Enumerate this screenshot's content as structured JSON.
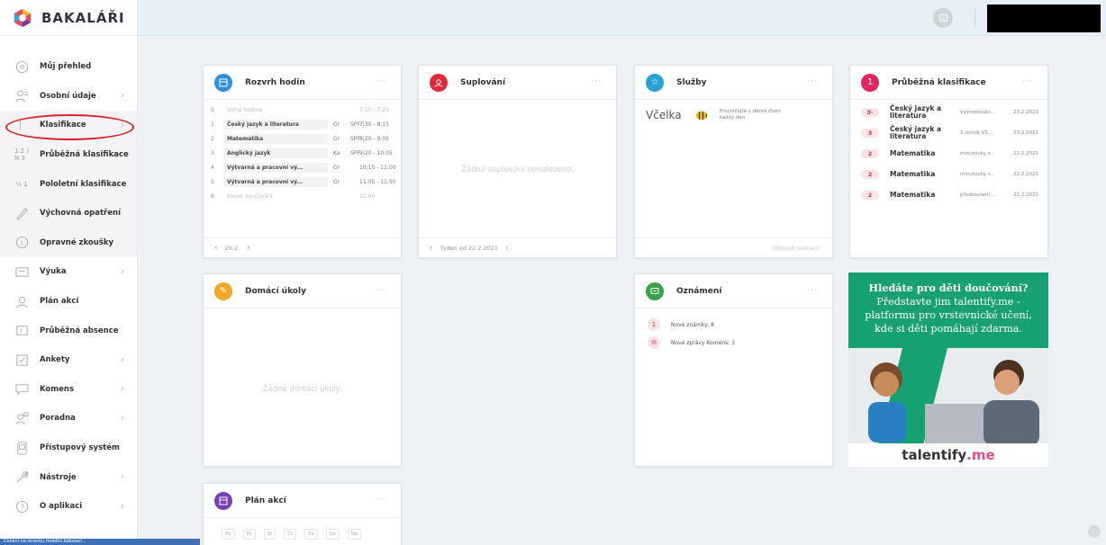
{
  "brand": {
    "name": "BAKALÁŘI"
  },
  "nav": [
    {
      "label": "Můj přehled",
      "icon": "dashboard-icon",
      "chevron": false
    },
    {
      "label": "Osobní údaje",
      "icon": "person-icon",
      "chevron": true
    },
    {
      "label": "Klasifikace",
      "icon": "grades-icon",
      "chevron": true
    },
    {
      "label": "Průběžná klasifikace",
      "icon": "ongoing-grades-icon",
      "chevron": false,
      "glyph": "1 2 / N 3"
    },
    {
      "label": "Pololetní klasifikace",
      "icon": "semester-grades-icon",
      "chevron": false,
      "glyph": "½ 1"
    },
    {
      "label": "Výchovná opatření",
      "icon": "pen-icon",
      "chevron": false
    },
    {
      "label": "Opravné zkoušky",
      "icon": "retake-exam-icon",
      "chevron": false
    },
    {
      "label": "Výuka",
      "icon": "teaching-icon",
      "chevron": true
    },
    {
      "label": "Plán akcí",
      "icon": "events-plan-icon",
      "chevron": false
    },
    {
      "label": "Průběžná absence",
      "icon": "absence-icon",
      "chevron": false
    },
    {
      "label": "Ankety",
      "icon": "survey-icon",
      "chevron": true
    },
    {
      "label": "Komens",
      "icon": "messages-icon",
      "chevron": true
    },
    {
      "label": "Poradna",
      "icon": "counseling-icon",
      "chevron": true
    },
    {
      "label": "Přístupový systém",
      "icon": "access-system-icon",
      "chevron": false
    },
    {
      "label": "Nástroje",
      "icon": "tools-icon",
      "chevron": true
    },
    {
      "label": "O aplikaci",
      "icon": "help-icon",
      "chevron": true
    }
  ],
  "bottom_status": "Čekání na stránku mobilní.bakalari...",
  "schedule": {
    "title": "Rozvrh hodin",
    "menu": "···",
    "rows": [
      {
        "num": "0",
        "subject": "Volná hodina",
        "teacher": "",
        "room": "",
        "time": "7:15 - 7:25",
        "plain": true
      },
      {
        "num": "1",
        "subject": "Český jazyk a literatura",
        "teacher": "Gr",
        "room": "SPF",
        "time": "7:30 - 8:15",
        "plain": false
      },
      {
        "num": "2",
        "subject": "Matematika",
        "teacher": "Gr",
        "room": "SPF",
        "time": "8:20 - 9:05",
        "plain": false
      },
      {
        "num": "3",
        "subject": "Anglický jazyk",
        "teacher": "Ka",
        "room": "SPF",
        "time": "9:20 - 10:05",
        "plain": false
      },
      {
        "num": "4",
        "subject": "Výtvarná a pracovní vý...",
        "teacher": "Gr",
        "room": "",
        "time": "10:15 - 11:00",
        "plain": false
      },
      {
        "num": "5",
        "subject": "Výtvarná a pracovní vý...",
        "teacher": "Gr",
        "room": "",
        "time": "11:05 - 11:50",
        "plain": false
      },
      {
        "num": "6",
        "subject": "Konec vyučování",
        "teacher": "",
        "room": "",
        "time": "12:00",
        "plain": true
      }
    ],
    "footer": "26.2."
  },
  "substitution": {
    "title": "Suplování",
    "menu": "···",
    "empty": "Žádné suplování nenalezeno.",
    "footer": "Týden od 22.2.2021"
  },
  "services": {
    "title": "Služby",
    "menu": "···",
    "service_name": "Včelka",
    "service_desc": "Procvičujte s dětmi čtení každý den",
    "footer": "Obnovit seznam"
  },
  "grades": {
    "title": "Průběžná klasifikace",
    "badge": "1",
    "menu": "···",
    "rows": [
      {
        "grade": "3-",
        "subject": "Český jazyk a literatura",
        "note": "vyjmenován...",
        "date": "23.2.2021"
      },
      {
        "grade": "3",
        "subject": "Český jazyk a literatura",
        "note": "3.ročník VS ...",
        "date": "23.2.2021"
      },
      {
        "grade": "2",
        "subject": "Matematika",
        "note": "minutovky s...",
        "date": "22.2.2021"
      },
      {
        "grade": "2",
        "subject": "Matematika",
        "note": "minutovky s...",
        "date": "22.2.2021"
      },
      {
        "grade": "2",
        "subject": "Matematika",
        "note": "přezkoušení ...",
        "date": "22.2.2021"
      }
    ]
  },
  "homework": {
    "title": "Domácí úkoly",
    "menu": "···",
    "empty": "Žádné domácí úkoly."
  },
  "announcements": {
    "title": "Oznámení",
    "menu": "···",
    "rows": [
      {
        "icon": "1",
        "text": "Nové známky: 8"
      },
      {
        "icon": "✉",
        "text": "Nové zprávy Komens: 3"
      }
    ]
  },
  "ad": {
    "line1": "Hledáte pro děti doučování?",
    "line2": "Představte jim talentify.me -",
    "line3": "platformu pro vrstevnické učení,",
    "line4": "kde si děti pomáhají zdarma.",
    "logo_a": "talentify",
    "logo_b": ".me"
  },
  "events": {
    "title": "Plán akcí",
    "menu": "···",
    "days": [
      "Po",
      "Út",
      "St",
      "Čt",
      "Pá",
      "So",
      "Ne"
    ]
  },
  "colors": {
    "schedule": "#2f8fd8",
    "substitution": "#e02a3a",
    "services": "#27a3d6",
    "grades": "#e3255f",
    "homework": "#f5a623",
    "announcements": "#3aa34a",
    "events": "#7a3fb0",
    "ad": "#17a173"
  }
}
